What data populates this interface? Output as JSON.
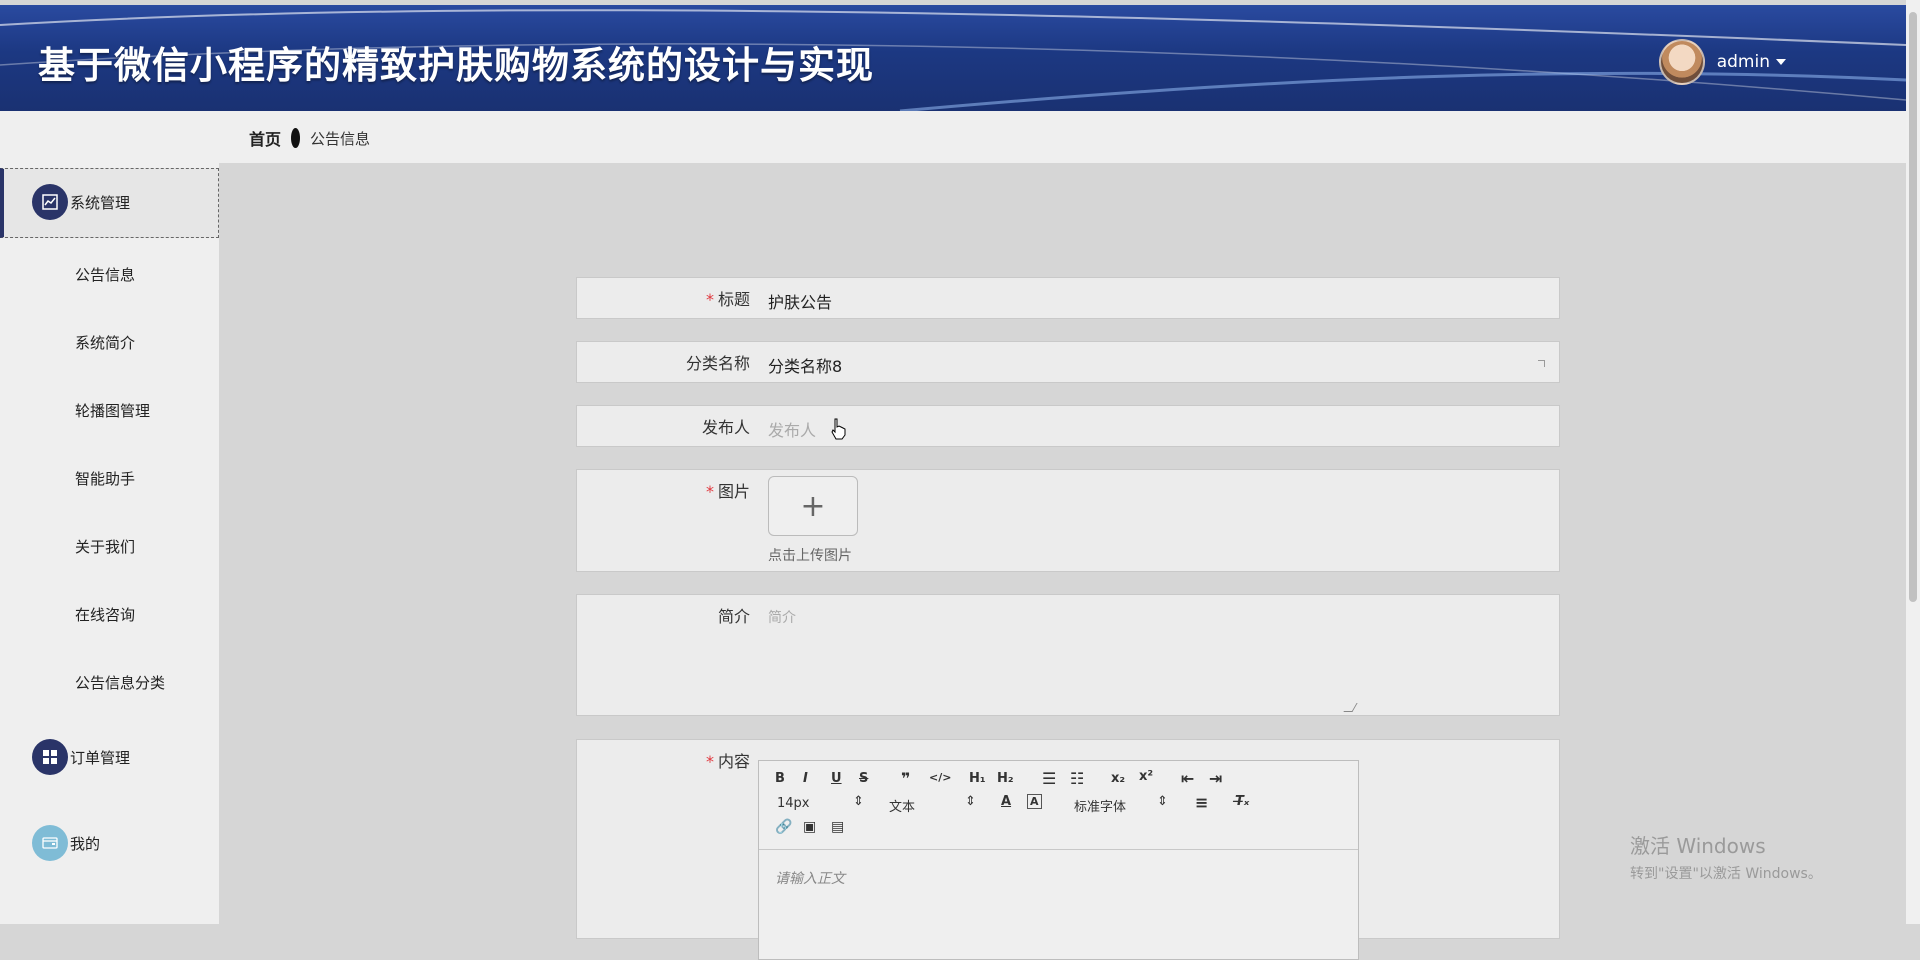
{
  "header": {
    "title": "基于微信小程序的精致护肤购物系统的设计与实现",
    "user": "admin"
  },
  "breadcrumb": {
    "home": "首页",
    "current": "公告信息"
  },
  "sidebar": {
    "group1": "系统管理",
    "items": [
      "公告信息",
      "系统简介",
      "轮播图管理",
      "智能助手",
      "关于我们",
      "在线咨询",
      "公告信息分类"
    ],
    "group2": "订单管理",
    "group3": "我的"
  },
  "form": {
    "title_label": "标题",
    "title_value": "护肤公告",
    "category_label": "分类名称",
    "category_value": "分类名称8",
    "publisher_label": "发布人",
    "publisher_placeholder": "发布人",
    "image_label": "图片",
    "upload_tip": "点击上传图片",
    "intro_label": "简介",
    "intro_placeholder": "简介",
    "content_label": "内容",
    "editor": {
      "font_size": "14px",
      "block_type": "文本",
      "font_family": "标准字体",
      "placeholder": "请输入正文"
    }
  },
  "watermark": {
    "line1": "激活 Windows",
    "line2": "转到\"设置\"以激活 Windows。"
  },
  "colors": {
    "header_blue": "#1c3882",
    "sidebar_active_border": "#2a3468",
    "required_star": "#e0383e"
  }
}
